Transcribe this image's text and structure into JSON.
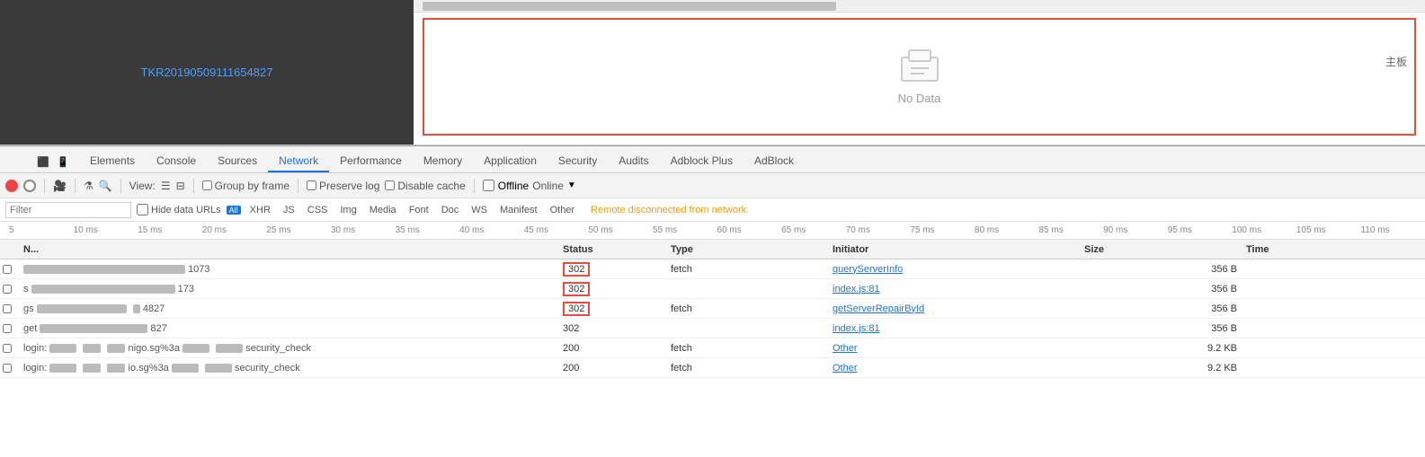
{
  "topLeft": {
    "link": "TKR20190509111654827"
  },
  "topRight": {
    "label": "主板",
    "noData": "No Data"
  },
  "tabs": {
    "items": [
      {
        "label": "Elements",
        "active": false
      },
      {
        "label": "Console",
        "active": false
      },
      {
        "label": "Sources",
        "active": false
      },
      {
        "label": "Network",
        "active": true
      },
      {
        "label": "Performance",
        "active": false
      },
      {
        "label": "Memory",
        "active": false
      },
      {
        "label": "Application",
        "active": false
      },
      {
        "label": "Security",
        "active": false
      },
      {
        "label": "Audits",
        "active": false
      },
      {
        "label": "Adblock Plus",
        "active": false
      },
      {
        "label": "AdBlock",
        "active": false
      }
    ]
  },
  "toolbar": {
    "viewLabel": "View:",
    "groupByFrame": "Group by frame",
    "preserveLog": "Preserve log",
    "disableCache": "Disable cache",
    "offline": "Offline",
    "online": "Online"
  },
  "filterRow": {
    "placeholder": "Filter",
    "hideDataUrls": "Hide data URLs",
    "badge": "All",
    "types": [
      "XHR",
      "JS",
      "CSS",
      "Img",
      "Media",
      "Font",
      "Doc",
      "WS",
      "Manifest",
      "Other"
    ],
    "activeType": "All",
    "disconnected": "Remote disconnected from network."
  },
  "timeline": {
    "ticks": [
      "5",
      "10 ms",
      "15 ms",
      "20 ms",
      "25 ms",
      "30 ms",
      "35 ms",
      "40 ms",
      "45 ms",
      "50 ms",
      "55 ms",
      "60 ms",
      "65 ms",
      "70 ms",
      "75 ms",
      "80 ms",
      "85 ms",
      "90 ms",
      "95 ms",
      "100 ms",
      "105 ms",
      "110 ms"
    ]
  },
  "tableHeader": {
    "name": "N...",
    "status": "Status",
    "type": "Type",
    "initiator": "Initiator",
    "size": "Size",
    "time": "Time"
  },
  "rows": [
    {
      "name": "████████████████ 1073",
      "statusBoxed": true,
      "status": "302",
      "type": "fetch",
      "initiator": "queryServerInfo",
      "size": "356 B",
      "time": ""
    },
    {
      "name": "s███████████████ 173",
      "statusBoxed": true,
      "status": "302",
      "type": "",
      "initiator": "index.js:81",
      "size": "356 B",
      "time": ""
    },
    {
      "name": "gs█████████ █ 4827",
      "statusBoxed": true,
      "status": "302",
      "type": "fetch",
      "initiator": "getServerRepairById",
      "size": "356 B",
      "time": ""
    },
    {
      "name": "get████████ 827",
      "statusBoxed": false,
      "status": "302",
      "type": "",
      "initiator": "index.js:81",
      "size": "356 B",
      "time": ""
    },
    {
      "name": "login:███ ██ ██ nigo.sg%3a█ ██ security_check",
      "statusBoxed": false,
      "status": "200",
      "type": "fetch",
      "initiator": "Other",
      "size": "9.2 KB",
      "time": ""
    },
    {
      "name": "login:███ ██ ██ io.sg%3a█ ██ security_check",
      "statusBoxed": false,
      "status": "200",
      "type": "fetch",
      "initiator": "Other",
      "size": "9.2 KB",
      "time": ""
    }
  ]
}
